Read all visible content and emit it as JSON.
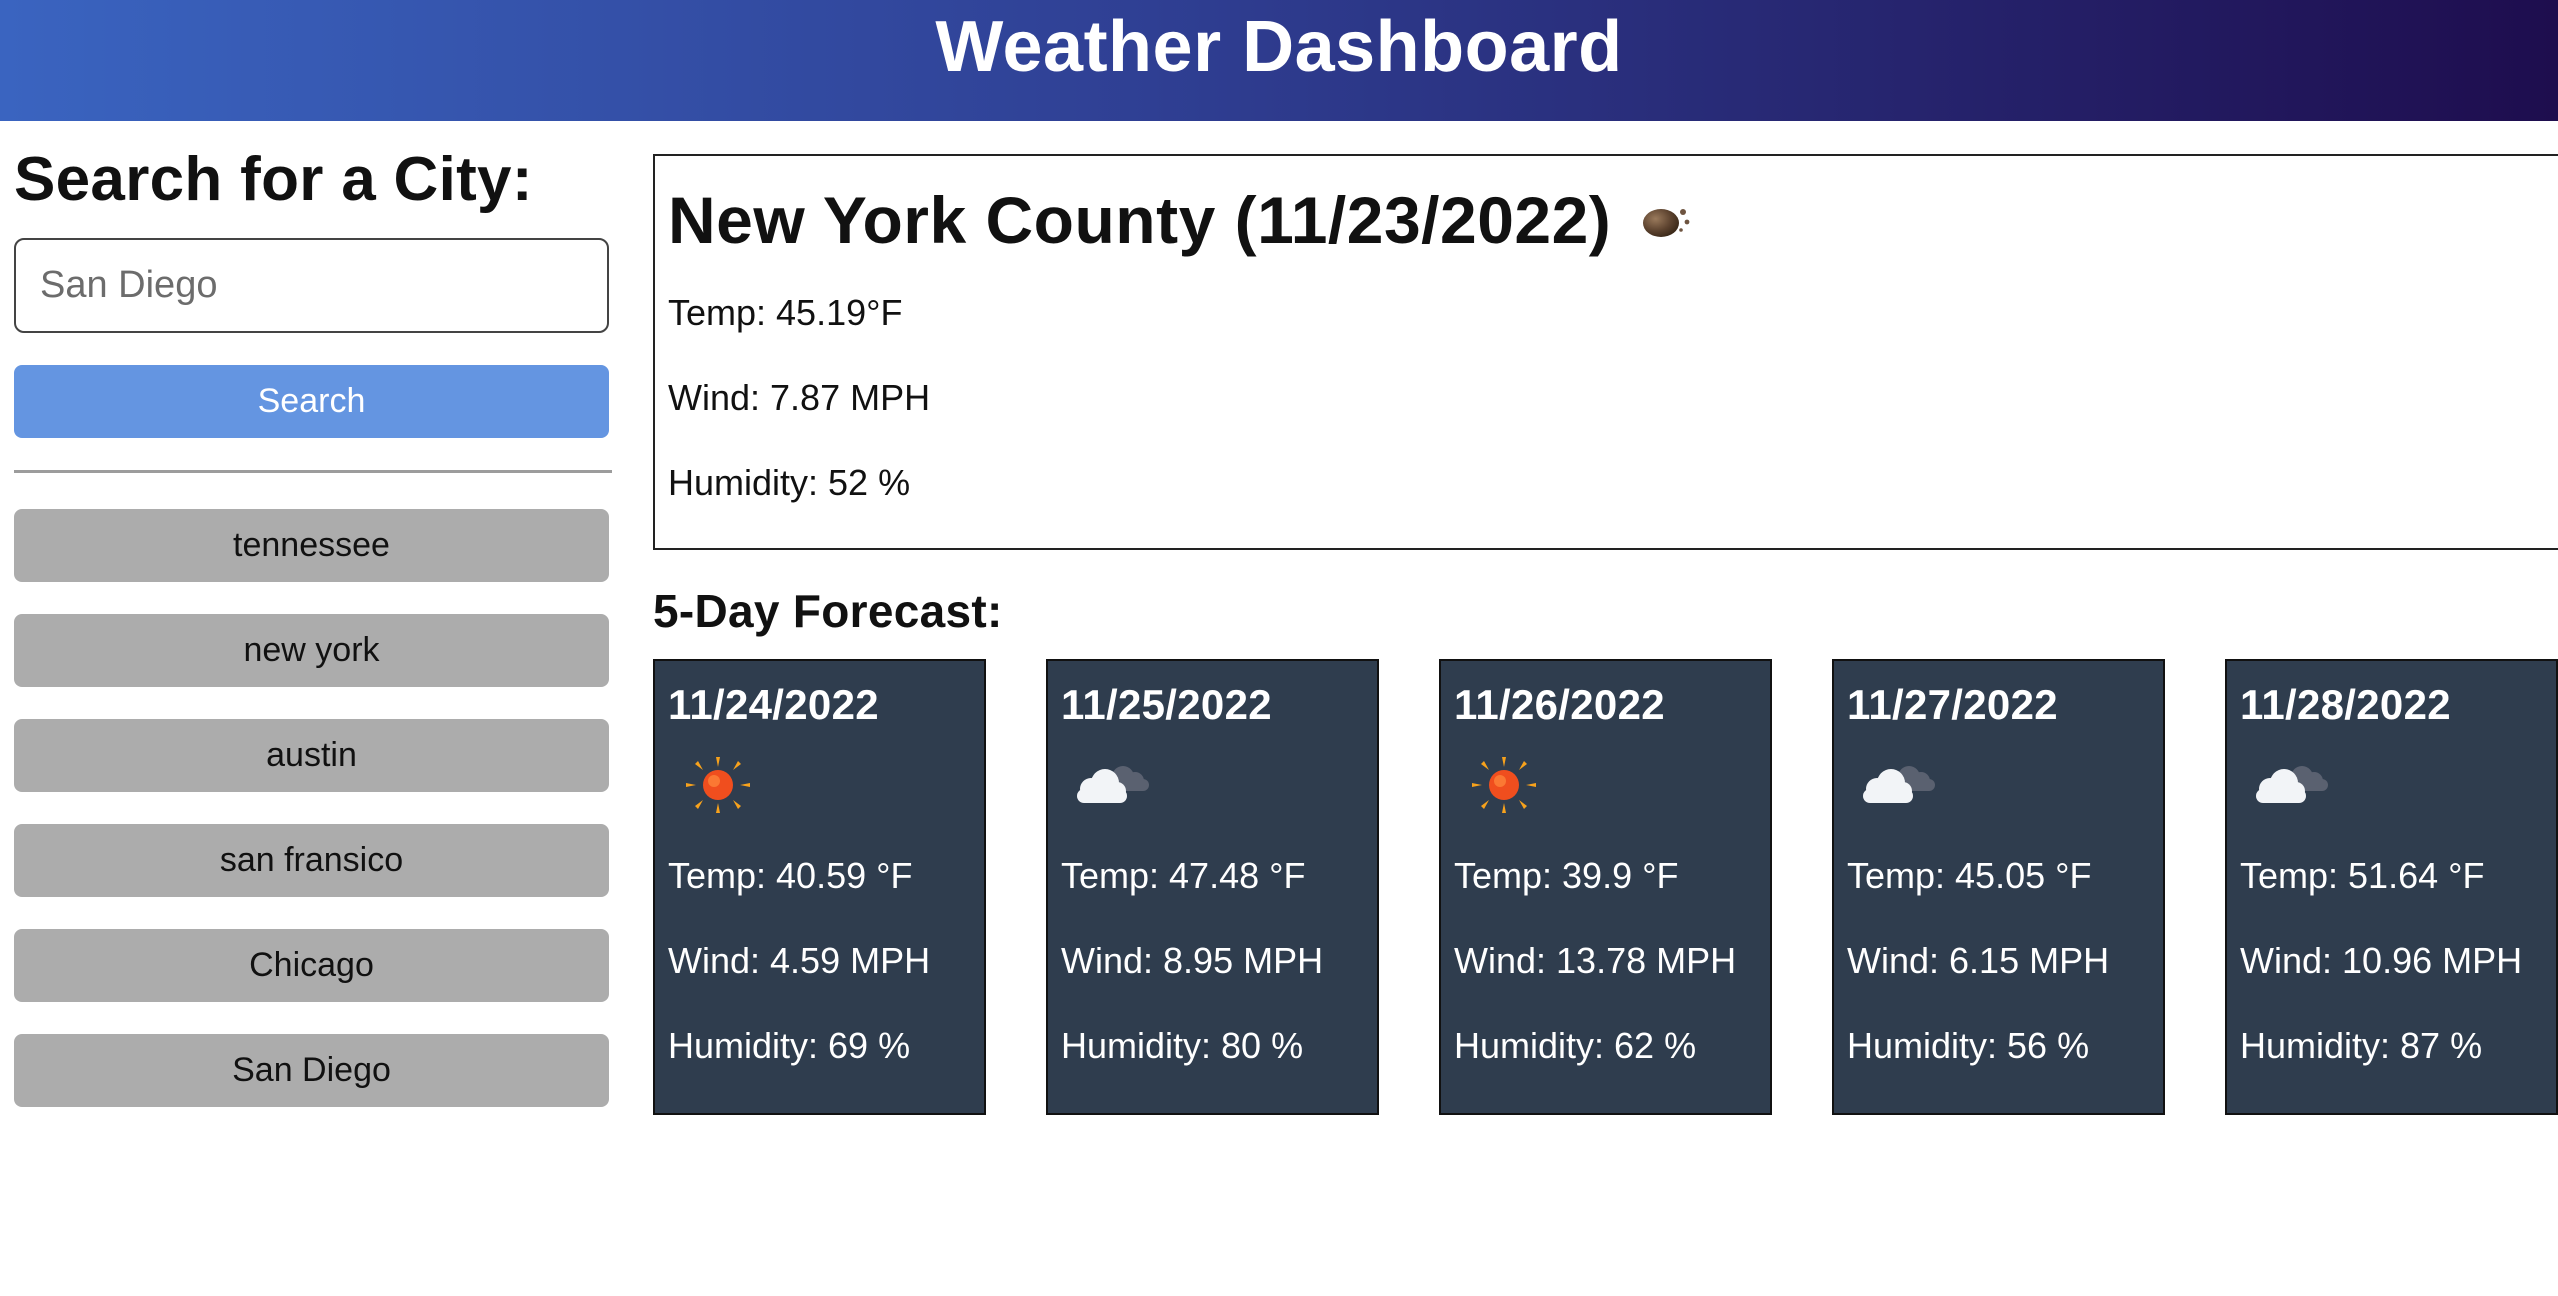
{
  "header": {
    "title": "Weather Dashboard"
  },
  "sidebar": {
    "heading": "Search for a City:",
    "search_placeholder": "San Diego",
    "search_value": "",
    "search_button_label": "Search",
    "history": [
      "tennessee",
      "new york",
      "austin",
      "san fransico",
      "Chicago",
      "San Diego"
    ]
  },
  "current": {
    "title": "New York County (11/23/2022)",
    "icon": "fog-moon-icon",
    "temp": "Temp: 45.19°F",
    "wind": "Wind: 7.87 MPH",
    "humidity": "Humidity: 52 %"
  },
  "forecast": {
    "title": "5-Day Forecast:",
    "days": [
      {
        "date": "11/24/2022",
        "icon": "sun-icon",
        "temp": "Temp: 40.59 °F",
        "wind": "Wind: 4.59 MPH",
        "humidity": "Humidity: 69 %"
      },
      {
        "date": "11/25/2022",
        "icon": "clouds-icon",
        "temp": "Temp: 47.48 °F",
        "wind": "Wind: 8.95 MPH",
        "humidity": "Humidity: 80 %"
      },
      {
        "date": "11/26/2022",
        "icon": "sun-icon",
        "temp": "Temp: 39.9 °F",
        "wind": "Wind: 13.78 MPH",
        "humidity": "Humidity: 62 %"
      },
      {
        "date": "11/27/2022",
        "icon": "clouds-icon",
        "temp": "Temp: 45.05 °F",
        "wind": "Wind: 6.15 MPH",
        "humidity": "Humidity: 56 %"
      },
      {
        "date": "11/28/2022",
        "icon": "clouds-icon",
        "temp": "Temp: 51.64 °F",
        "wind": "Wind: 10.96 MPH",
        "humidity": "Humidity: 87 %"
      }
    ]
  },
  "colors": {
    "header_gradient_start": "#3a64c0",
    "header_gradient_end": "#1e0d4e",
    "search_button": "#6495e1",
    "history_button": "#acacac",
    "forecast_card": "#2f3d4e"
  }
}
